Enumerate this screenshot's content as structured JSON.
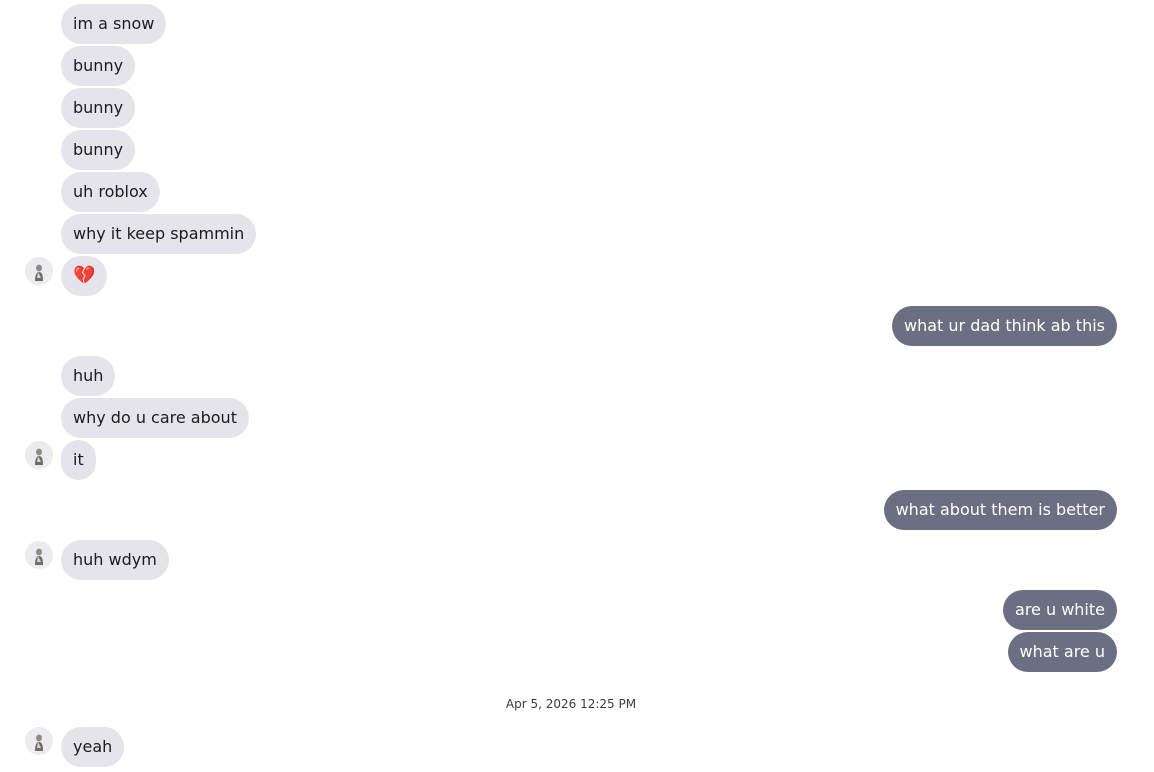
{
  "conversation": {
    "incoming_group_1": [
      "im a snow",
      "bunny",
      "bunny",
      "bunny",
      "uh roblox",
      "why it keep spammin",
      "💔"
    ],
    "outgoing_1": "what ur dad think ab this",
    "incoming_group_2": [
      "huh",
      "why do u care about",
      "it"
    ],
    "outgoing_2": "what about them is better",
    "incoming_3": "huh wdym",
    "outgoing_group_3": [
      "are u white",
      "what are u"
    ],
    "timestamp": "Apr 5, 2026 12:25 PM",
    "incoming_4": "yeah"
  },
  "avatar_icon": "user-avatar-icon"
}
